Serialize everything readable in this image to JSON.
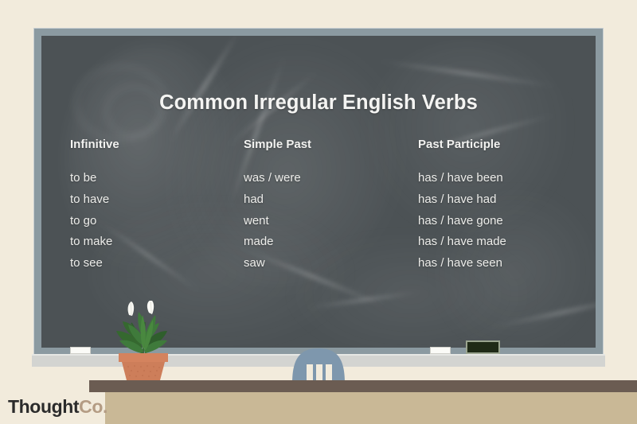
{
  "theme": {
    "page_background": "#F2EBDC",
    "board_surface": "#4C5255",
    "board_frame": "#8B9AA1",
    "chalk_text": "#EDEDEA",
    "ledge": "#D3D4D1",
    "desk_top": "#6B5C52",
    "desk_body": "#C9B896",
    "chair": "#7E97AD",
    "pot": "#D4835E",
    "leaf": "#3F7A3B",
    "eraser": "#1F2A16",
    "logo_primary": "#2B2B2B",
    "logo_accent": "#B49C84"
  },
  "board": {
    "title": "Common Irregular English Verbs",
    "columns": [
      {
        "key": "infinitive",
        "header": "Infinitive",
        "cells": [
          "to be",
          "to have",
          "to go",
          "to make",
          "to see"
        ]
      },
      {
        "key": "simple_past",
        "header": "Simple Past",
        "cells": [
          "was / were",
          "had",
          "went",
          "made",
          "saw"
        ]
      },
      {
        "key": "past_participle",
        "header": "Past Participle",
        "cells": [
          "has / have been",
          "has / have had",
          "has / have gone",
          "has / have made",
          "has / have seen"
        ]
      }
    ]
  },
  "objects": {
    "chalk_left": "chalk-stick",
    "chalk_right": "chalk-stick",
    "eraser": "blackboard-eraser",
    "plant": "potted-peace-lily",
    "chair": "classroom-chair",
    "desk": "teacher-desk"
  },
  "logo": {
    "primary": "Thought",
    "accent": "Co."
  }
}
